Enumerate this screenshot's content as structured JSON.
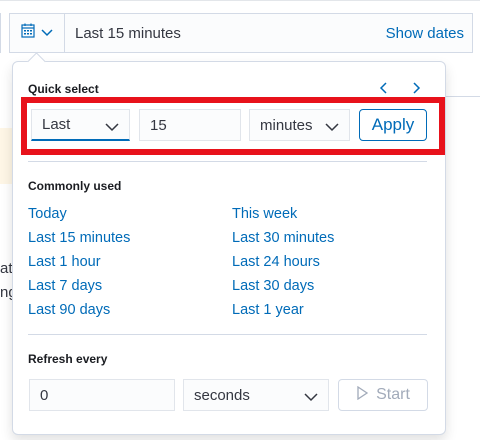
{
  "background": {
    "text_fragment_1": "ate",
    "text_fragment_2": "ng"
  },
  "picker": {
    "calendar_icon": "calendar-icon",
    "label": "Last 15 minutes",
    "show_dates": "Show dates"
  },
  "quick_select": {
    "title": "Quick select",
    "direction_value": "Last",
    "amount_value": "15",
    "unit_value": "minutes",
    "apply_label": "Apply"
  },
  "commonly_used": {
    "title": "Commonly used",
    "left": [
      "Today",
      "Last 15 minutes",
      "Last 1 hour",
      "Last 7 days",
      "Last 90 days"
    ],
    "right": [
      "This week",
      "Last 30 minutes",
      "Last 24 hours",
      "Last 30 days",
      "Last 1 year"
    ]
  },
  "refresh": {
    "title": "Refresh every",
    "interval_value": "0",
    "unit_value": "seconds",
    "start_label": "Start"
  },
  "colors": {
    "link": "#006bb8",
    "highlight": "#e8121b",
    "border": "#d3dae6"
  }
}
